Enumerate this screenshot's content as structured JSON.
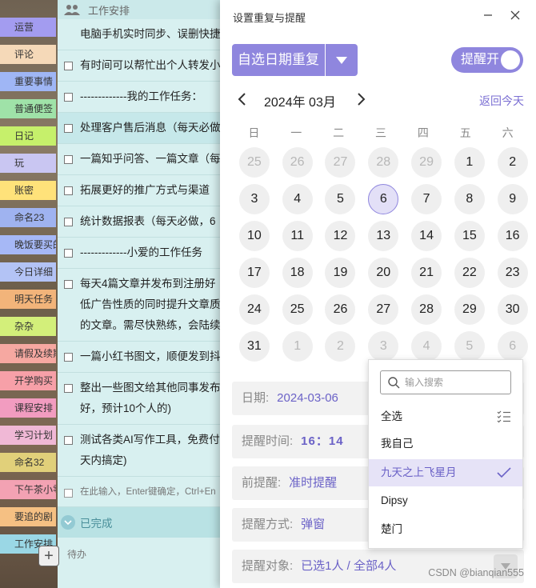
{
  "tags": [
    {
      "label": "运营",
      "color": "#a39cf0"
    },
    {
      "label": "评论",
      "color": "#f5d9b8"
    },
    {
      "label": "重要事情",
      "color": "#9fb6f5"
    },
    {
      "label": "普通便签",
      "color": "#9fe2a8"
    },
    {
      "label": "日记",
      "color": "#c6f06b"
    },
    {
      "label": "玩",
      "color": "#c9c6f2"
    },
    {
      "label": "账密",
      "color": "#ffe27a"
    },
    {
      "label": "命名23",
      "color": "#9fb3f0"
    },
    {
      "label": "晚饭要买的",
      "color": "#a6b8f6"
    },
    {
      "label": "今日详细",
      "color": "#b3c3f5"
    },
    {
      "label": "明天任务",
      "color": "#f2b47a"
    },
    {
      "label": "杂杂",
      "color": "#d3ef7a"
    },
    {
      "label": "请假及续期",
      "color": "#f6a8a1"
    },
    {
      "label": "开学购买",
      "color": "#f7a0a8"
    },
    {
      "label": "课程安排",
      "color": "#f29cc0"
    },
    {
      "label": "学习计划",
      "color": "#f0b8d6"
    },
    {
      "label": "命名32",
      "color": "#e1d07a"
    },
    {
      "label": "下午茶小零",
      "color": "#f3a2b3"
    },
    {
      "label": "要追的剧",
      "color": "#f5c083"
    },
    {
      "label": "工作安排",
      "color": "#9ad7e5"
    }
  ],
  "task_list": {
    "header": "工作安排",
    "tasks": [
      {
        "text": "电脑手机实时同步、误删快捷",
        "first": true
      },
      {
        "text": "有时间可以帮忙出个人转发小"
      },
      {
        "text": "-------------我的工作任务："
      },
      {
        "text": "处理客户售后消息（每天必做",
        "highlight": true
      },
      {
        "text": "一篇知乎问答、一篇文章（每"
      },
      {
        "text": "拓展更好的推广方式与渠道"
      },
      {
        "text": "统计数据报表（每天必做，6"
      },
      {
        "text": "-------------小爱的工作任务"
      },
      {
        "text": "每天4篇文章并发布到注册好",
        "line2": "低广告性质的同时提升文章质",
        "line3": "的文章。需尽快熟练，会陆续"
      },
      {
        "text": "一篇小红书图文，顺便发到抖"
      },
      {
        "text": "整出一些图文给其他同事发布",
        "line2": "好，预计10个人的)"
      },
      {
        "text": "测试各类AI写作工具，免费付",
        "line2": "天内搞定)"
      }
    ],
    "input_placeholder": "在此输入，Enter键确定，Ctrl+En",
    "done_label": "已完成",
    "pending_label": "待办"
  },
  "dialog": {
    "title": "设置重复与提醒",
    "repeat_label": "自选日期重复",
    "remind_toggle": "提醒开",
    "month_label": "2024年 03月",
    "today_link": "返回今天",
    "weekdays": [
      "日",
      "一",
      "二",
      "三",
      "四",
      "五",
      "六"
    ],
    "days": [
      {
        "d": "25",
        "m": true
      },
      {
        "d": "26",
        "m": true
      },
      {
        "d": "27",
        "m": true
      },
      {
        "d": "28",
        "m": true
      },
      {
        "d": "29",
        "m": true
      },
      {
        "d": "1"
      },
      {
        "d": "2"
      },
      {
        "d": "3"
      },
      {
        "d": "4"
      },
      {
        "d": "5"
      },
      {
        "d": "6",
        "sel": true
      },
      {
        "d": "7"
      },
      {
        "d": "8"
      },
      {
        "d": "9"
      },
      {
        "d": "10"
      },
      {
        "d": "11"
      },
      {
        "d": "12"
      },
      {
        "d": "13"
      },
      {
        "d": "14"
      },
      {
        "d": "15"
      },
      {
        "d": "16"
      },
      {
        "d": "17"
      },
      {
        "d": "18"
      },
      {
        "d": "19"
      },
      {
        "d": "20"
      },
      {
        "d": "21"
      },
      {
        "d": "22"
      },
      {
        "d": "23"
      },
      {
        "d": "24"
      },
      {
        "d": "25"
      },
      {
        "d": "26"
      },
      {
        "d": "27"
      },
      {
        "d": "28"
      },
      {
        "d": "29"
      },
      {
        "d": "30"
      },
      {
        "d": "31"
      },
      {
        "d": "1",
        "m": true
      },
      {
        "d": "2",
        "m": true
      },
      {
        "d": "3",
        "m": true
      },
      {
        "d": "4",
        "m": true
      },
      {
        "d": "5",
        "m": true
      },
      {
        "d": "6",
        "m": true
      }
    ],
    "date_label": "日期:",
    "date_value": "2024-03-06",
    "time_label": "提醒时间:",
    "time_value": "16：14",
    "advance_label": "前提醒:",
    "advance_value": "准时提醒",
    "method_label": "提醒方式:",
    "method_value": "弹窗",
    "target_label": "提醒对象:",
    "target_value": "已选1人 / 全部4人"
  },
  "popup": {
    "search_placeholder": "输入搜索",
    "select_all": "全选",
    "options": [
      "我自己",
      "九天之上飞星月",
      "Dipsy",
      "楚门"
    ],
    "selected_index": 1
  },
  "watermark": "CSDN @bianqian555",
  "colors": {
    "accent": "#8f86de",
    "accent_text": "#6b62c7",
    "selected_bg": "#e3e0f7"
  }
}
